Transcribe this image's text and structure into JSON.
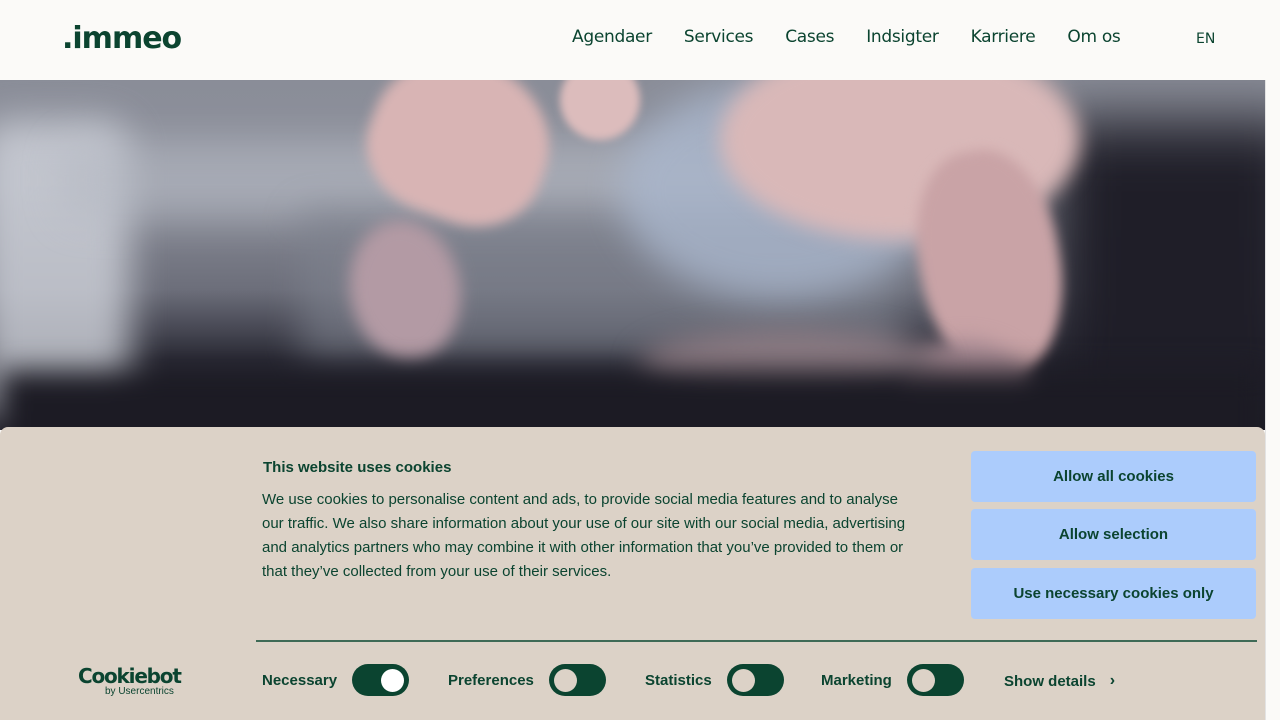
{
  "header": {
    "logo": ".immeo",
    "nav": [
      "Agendaer",
      "Services",
      "Cases",
      "Indsigter",
      "Karriere",
      "Om os"
    ],
    "language": "EN"
  },
  "hero": {
    "image_description": "close-up of a finger touching a tablet screen"
  },
  "cookie_banner": {
    "title": "This website uses cookies",
    "text": "We use cookies to personalise content and ads, to provide social media features and to analyse our traffic. We also share information about your use of our site with our social media, advertising and analytics partners who may combine it with other information that you’ve provided to them or that they’ve collected from your use of their services.",
    "buttons": {
      "allow_all": "Allow all cookies",
      "allow_selection": "Allow selection",
      "necessary_only": "Use necessary cookies only"
    },
    "logo": {
      "main": "Cookiebot",
      "sub": "by Usercentrics"
    },
    "toggles": [
      {
        "label": "Necessary",
        "state": "on"
      },
      {
        "label": "Preferences",
        "state": "off"
      },
      {
        "label": "Statistics",
        "state": "off"
      },
      {
        "label": "Marketing",
        "state": "off"
      }
    ],
    "show_details": "Show details",
    "chevron": "›"
  },
  "colors": {
    "brand_green": "#0b4430",
    "banner_bg": "#dcd2c7",
    "button_bg": "#acccfc",
    "page_bg": "#fbfaf8"
  }
}
